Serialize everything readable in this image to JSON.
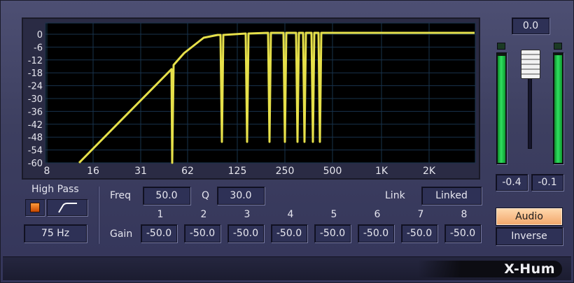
{
  "graph": {
    "y_labels": [
      "0",
      "-6",
      "-12",
      "-18",
      "-24",
      "-30",
      "-36",
      "-42",
      "-48",
      "-54",
      "-60"
    ],
    "x_labels": [
      "8",
      "16",
      "31",
      "62",
      "125",
      "250",
      "500",
      "1K",
      "2K"
    ],
    "curve_color": "#e6e04a",
    "background_color": "#000000",
    "grid_color": "#18334d"
  },
  "highpass": {
    "title": "High Pass",
    "frequency": "75 Hz"
  },
  "controls": {
    "freq_label": "Freq",
    "freq_value": "50.0",
    "q_label": "Q",
    "q_value": "30.0",
    "link_label": "Link",
    "link_value": "Linked",
    "gain_label": "Gain",
    "bands": [
      {
        "number": "1",
        "gain": "-50.0"
      },
      {
        "number": "2",
        "gain": "-50.0"
      },
      {
        "number": "3",
        "gain": "-50.0"
      },
      {
        "number": "4",
        "gain": "-50.0"
      },
      {
        "number": "5",
        "gain": "-50.0"
      },
      {
        "number": "6",
        "gain": "-50.0"
      },
      {
        "number": "7",
        "gain": "-50.0"
      },
      {
        "number": "8",
        "gain": "-50.0"
      }
    ]
  },
  "output": {
    "fader_value": "0.0",
    "meter_left_value": "-0.4",
    "meter_right_value": "-0.1",
    "meter_left_level": 0.98,
    "meter_right_level": 0.99,
    "meter_color": "#30e060"
  },
  "mode": {
    "audio_label": "Audio",
    "inverse_label": "Inverse",
    "active": "Audio",
    "active_color": "#f2a66a"
  },
  "brand": "X-Hum"
}
